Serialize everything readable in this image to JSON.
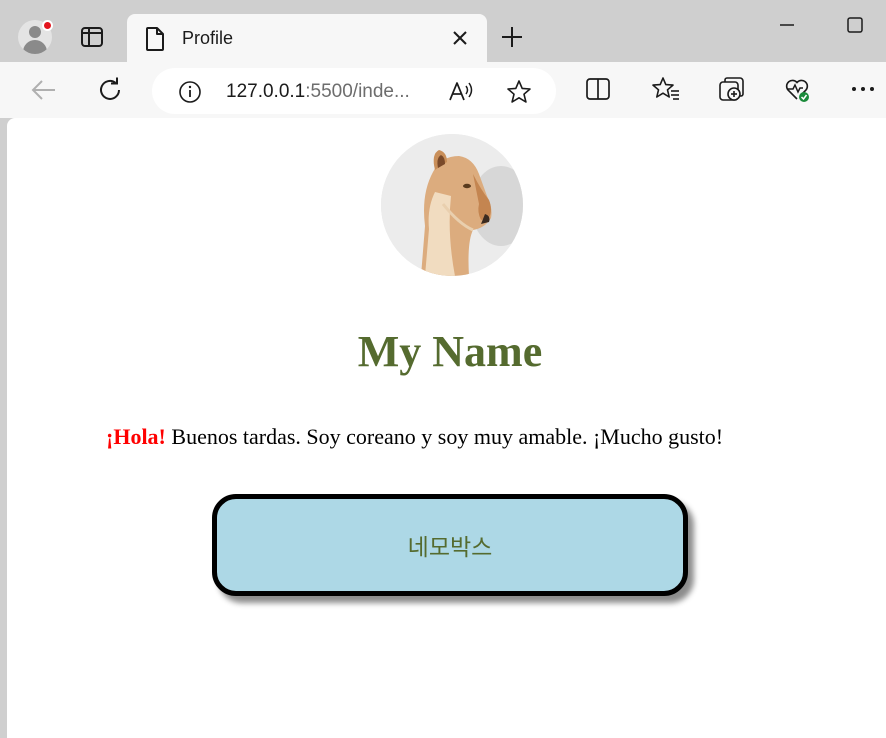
{
  "browser": {
    "tab_title": "Profile",
    "url_host": "127.0.0.1",
    "url_rest": ":5500/inde..."
  },
  "page": {
    "heading": "My Name",
    "greeting": "¡Hola!",
    "intro_text": " Buenos tardas. Soy coreano y soy muy amable. ¡Mucho gusto!",
    "box_text": "네모박스"
  },
  "colors": {
    "heading": "#556b2f",
    "greeting": "#ff0000",
    "box_background": "#add8e6",
    "box_text": "#556b2f"
  },
  "icons": [
    "profile-icon",
    "tab-actions-icon",
    "page-icon",
    "close-icon",
    "new-tab-icon",
    "minimize-icon",
    "maximize-icon",
    "back-icon",
    "refresh-icon",
    "info-icon",
    "read-aloud-icon",
    "favorite-icon",
    "split-screen-icon",
    "favorites-icon",
    "collections-icon",
    "browser-essentials-icon",
    "more-icon"
  ]
}
